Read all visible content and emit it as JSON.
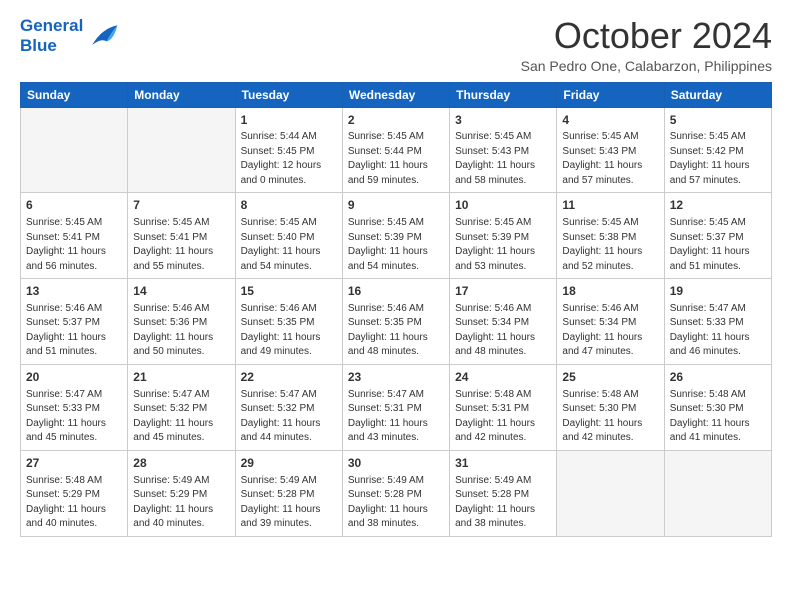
{
  "logo": {
    "line1": "General",
    "line2": "Blue"
  },
  "title": "October 2024",
  "subtitle": "San Pedro One, Calabarzon, Philippines",
  "weekdays": [
    "Sunday",
    "Monday",
    "Tuesday",
    "Wednesday",
    "Thursday",
    "Friday",
    "Saturday"
  ],
  "weeks": [
    [
      {
        "day": "",
        "info": ""
      },
      {
        "day": "",
        "info": ""
      },
      {
        "day": "1",
        "info": "Sunrise: 5:44 AM\nSunset: 5:45 PM\nDaylight: 12 hours\nand 0 minutes."
      },
      {
        "day": "2",
        "info": "Sunrise: 5:45 AM\nSunset: 5:44 PM\nDaylight: 11 hours\nand 59 minutes."
      },
      {
        "day": "3",
        "info": "Sunrise: 5:45 AM\nSunset: 5:43 PM\nDaylight: 11 hours\nand 58 minutes."
      },
      {
        "day": "4",
        "info": "Sunrise: 5:45 AM\nSunset: 5:43 PM\nDaylight: 11 hours\nand 57 minutes."
      },
      {
        "day": "5",
        "info": "Sunrise: 5:45 AM\nSunset: 5:42 PM\nDaylight: 11 hours\nand 57 minutes."
      }
    ],
    [
      {
        "day": "6",
        "info": "Sunrise: 5:45 AM\nSunset: 5:41 PM\nDaylight: 11 hours\nand 56 minutes."
      },
      {
        "day": "7",
        "info": "Sunrise: 5:45 AM\nSunset: 5:41 PM\nDaylight: 11 hours\nand 55 minutes."
      },
      {
        "day": "8",
        "info": "Sunrise: 5:45 AM\nSunset: 5:40 PM\nDaylight: 11 hours\nand 54 minutes."
      },
      {
        "day": "9",
        "info": "Sunrise: 5:45 AM\nSunset: 5:39 PM\nDaylight: 11 hours\nand 54 minutes."
      },
      {
        "day": "10",
        "info": "Sunrise: 5:45 AM\nSunset: 5:39 PM\nDaylight: 11 hours\nand 53 minutes."
      },
      {
        "day": "11",
        "info": "Sunrise: 5:45 AM\nSunset: 5:38 PM\nDaylight: 11 hours\nand 52 minutes."
      },
      {
        "day": "12",
        "info": "Sunrise: 5:45 AM\nSunset: 5:37 PM\nDaylight: 11 hours\nand 51 minutes."
      }
    ],
    [
      {
        "day": "13",
        "info": "Sunrise: 5:46 AM\nSunset: 5:37 PM\nDaylight: 11 hours\nand 51 minutes."
      },
      {
        "day": "14",
        "info": "Sunrise: 5:46 AM\nSunset: 5:36 PM\nDaylight: 11 hours\nand 50 minutes."
      },
      {
        "day": "15",
        "info": "Sunrise: 5:46 AM\nSunset: 5:35 PM\nDaylight: 11 hours\nand 49 minutes."
      },
      {
        "day": "16",
        "info": "Sunrise: 5:46 AM\nSunset: 5:35 PM\nDaylight: 11 hours\nand 48 minutes."
      },
      {
        "day": "17",
        "info": "Sunrise: 5:46 AM\nSunset: 5:34 PM\nDaylight: 11 hours\nand 48 minutes."
      },
      {
        "day": "18",
        "info": "Sunrise: 5:46 AM\nSunset: 5:34 PM\nDaylight: 11 hours\nand 47 minutes."
      },
      {
        "day": "19",
        "info": "Sunrise: 5:47 AM\nSunset: 5:33 PM\nDaylight: 11 hours\nand 46 minutes."
      }
    ],
    [
      {
        "day": "20",
        "info": "Sunrise: 5:47 AM\nSunset: 5:33 PM\nDaylight: 11 hours\nand 45 minutes."
      },
      {
        "day": "21",
        "info": "Sunrise: 5:47 AM\nSunset: 5:32 PM\nDaylight: 11 hours\nand 45 minutes."
      },
      {
        "day": "22",
        "info": "Sunrise: 5:47 AM\nSunset: 5:32 PM\nDaylight: 11 hours\nand 44 minutes."
      },
      {
        "day": "23",
        "info": "Sunrise: 5:47 AM\nSunset: 5:31 PM\nDaylight: 11 hours\nand 43 minutes."
      },
      {
        "day": "24",
        "info": "Sunrise: 5:48 AM\nSunset: 5:31 PM\nDaylight: 11 hours\nand 42 minutes."
      },
      {
        "day": "25",
        "info": "Sunrise: 5:48 AM\nSunset: 5:30 PM\nDaylight: 11 hours\nand 42 minutes."
      },
      {
        "day": "26",
        "info": "Sunrise: 5:48 AM\nSunset: 5:30 PM\nDaylight: 11 hours\nand 41 minutes."
      }
    ],
    [
      {
        "day": "27",
        "info": "Sunrise: 5:48 AM\nSunset: 5:29 PM\nDaylight: 11 hours\nand 40 minutes."
      },
      {
        "day": "28",
        "info": "Sunrise: 5:49 AM\nSunset: 5:29 PM\nDaylight: 11 hours\nand 40 minutes."
      },
      {
        "day": "29",
        "info": "Sunrise: 5:49 AM\nSunset: 5:28 PM\nDaylight: 11 hours\nand 39 minutes."
      },
      {
        "day": "30",
        "info": "Sunrise: 5:49 AM\nSunset: 5:28 PM\nDaylight: 11 hours\nand 38 minutes."
      },
      {
        "day": "31",
        "info": "Sunrise: 5:49 AM\nSunset: 5:28 PM\nDaylight: 11 hours\nand 38 minutes."
      },
      {
        "day": "",
        "info": ""
      },
      {
        "day": "",
        "info": ""
      }
    ]
  ]
}
